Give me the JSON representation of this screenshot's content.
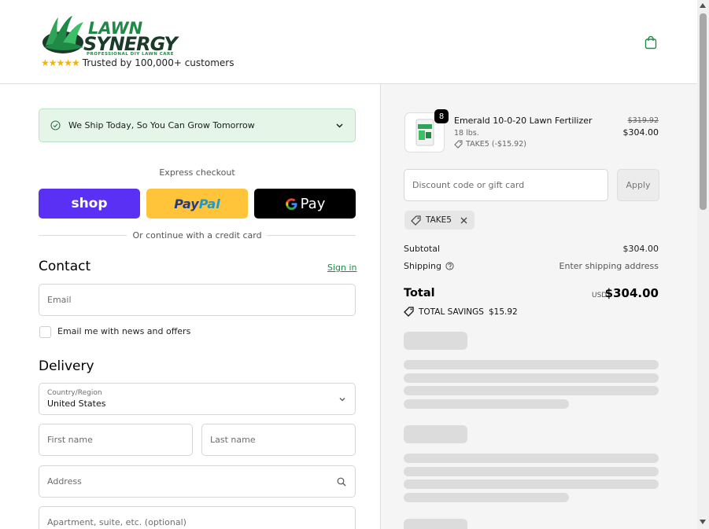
{
  "header": {
    "brand_line1": "LAWN",
    "brand_line2": "SYNERGY",
    "brand_tagline": "PROFESSIONAL DIY LAWN CARE",
    "stars": "★★★★★",
    "trust_text": "Trusted by 100,000+ customers",
    "cart_icon": "shopping-bag-icon"
  },
  "banner": {
    "text": "We Ship Today, So You Can Grow Tomorrow",
    "icon": "check-circle-icon",
    "chevron": "chevron-down-icon"
  },
  "express": {
    "label": "Express checkout",
    "shop_label": "shop",
    "paypal_label_pay": "Pay",
    "paypal_label_pal": "Pal",
    "gpay_label": "Pay",
    "divider_text": "Or continue with a credit card"
  },
  "contact": {
    "title": "Contact",
    "signin": "Sign in",
    "email_placeholder": "Email",
    "newsletter_label": "Email me with news and offers"
  },
  "delivery": {
    "title": "Delivery",
    "country_label": "Country/Region",
    "country_value": "United States",
    "first_name_placeholder": "First name",
    "last_name_placeholder": "Last name",
    "address_placeholder": "Address",
    "apartment_placeholder": "Apartment, suite, etc. (optional)"
  },
  "order": {
    "quantity": "8",
    "product_name": "Emerald 10-0-20 Lawn Fertilizer",
    "variant": "18 lbs.",
    "discount_line": "TAKE5 (-$15.92)",
    "old_price": "$319.92",
    "price": "$304.00",
    "discount_placeholder": "Discount code or gift card",
    "apply_label": "Apply",
    "applied_code": "TAKE5",
    "subtotal_label": "Subtotal",
    "subtotal_value": "$304.00",
    "shipping_label": "Shipping",
    "shipping_value": "Enter shipping address",
    "total_label": "Total",
    "currency": "USD",
    "total_value": "$304.00",
    "savings_label": "TOTAL SAVINGS",
    "savings_value": "$15.92"
  },
  "colors": {
    "brand_green": "#1f8a45",
    "shop_purple": "#5a31f4",
    "paypal_yellow": "#ffc439",
    "banner_bg": "#e5f6e9"
  }
}
